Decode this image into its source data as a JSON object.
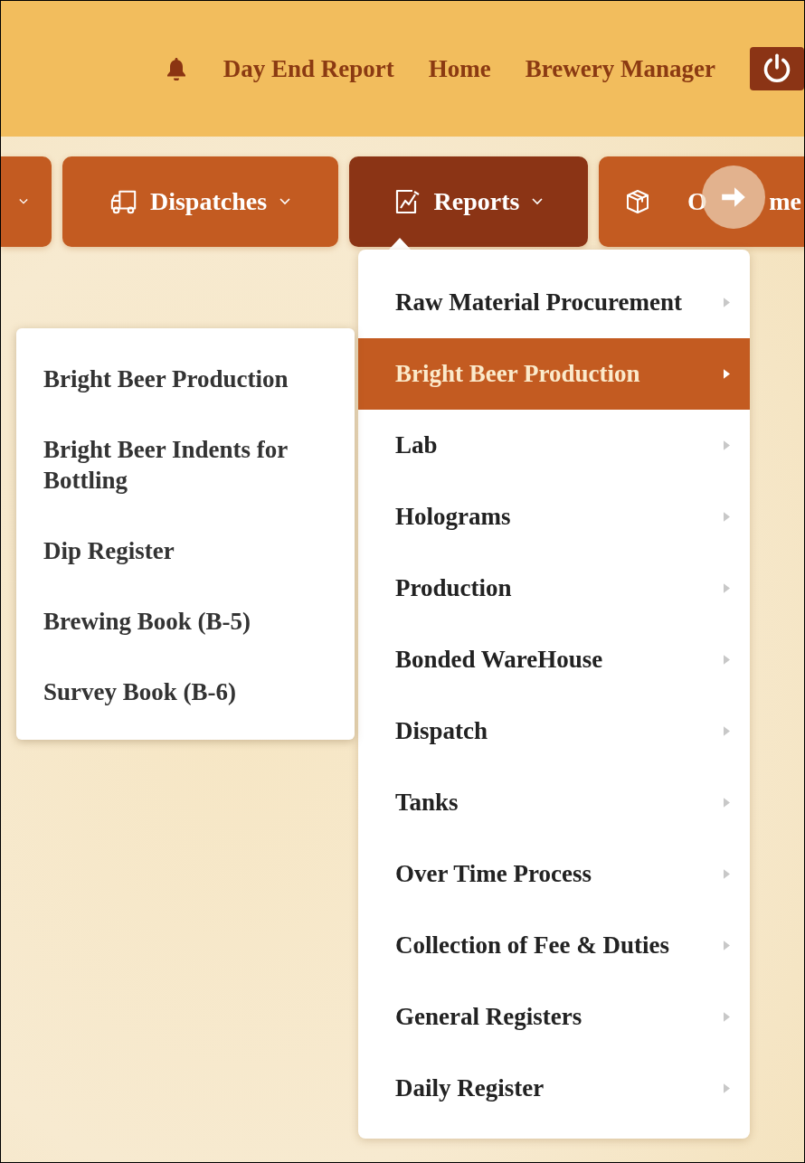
{
  "header": {
    "links": [
      {
        "label": "Day End Report"
      },
      {
        "label": "Home"
      },
      {
        "label": "Brewery Manager"
      }
    ]
  },
  "nav": [
    {
      "kind": "cut",
      "selected": false,
      "dropdown": true
    },
    {
      "kind": "item",
      "label": "Dispatches",
      "selected": false,
      "dropdown": true
    },
    {
      "kind": "item",
      "label": "Reports",
      "selected": true,
      "dropdown": true
    },
    {
      "kind": "item",
      "label": "O",
      "label_tail": "me",
      "selected": false,
      "dropdown": false
    }
  ],
  "reports_menu": {
    "items": [
      {
        "label": "Raw Material Procurement",
        "selected": false
      },
      {
        "label": "Bright Beer Production",
        "selected": true
      },
      {
        "label": "Lab",
        "selected": false
      },
      {
        "label": "Holograms",
        "selected": false
      },
      {
        "label": "Production",
        "selected": false
      },
      {
        "label": "Bonded WareHouse",
        "selected": false
      },
      {
        "label": "Dispatch",
        "selected": false
      },
      {
        "label": "Tanks",
        "selected": false
      },
      {
        "label": "Over Time Process",
        "selected": false
      },
      {
        "label": "Collection of Fee & Duties",
        "selected": false
      },
      {
        "label": "General Registers",
        "selected": false
      },
      {
        "label": "Daily Register",
        "selected": false
      }
    ]
  },
  "submenu": {
    "items": [
      {
        "label": "Bright Beer Production"
      },
      {
        "label": "Bright Beer Indents for Bottling"
      },
      {
        "label": "Dip Register"
      },
      {
        "label": "Brewing Book (B-5)"
      },
      {
        "label": "Survey Book (B-6)"
      }
    ]
  }
}
